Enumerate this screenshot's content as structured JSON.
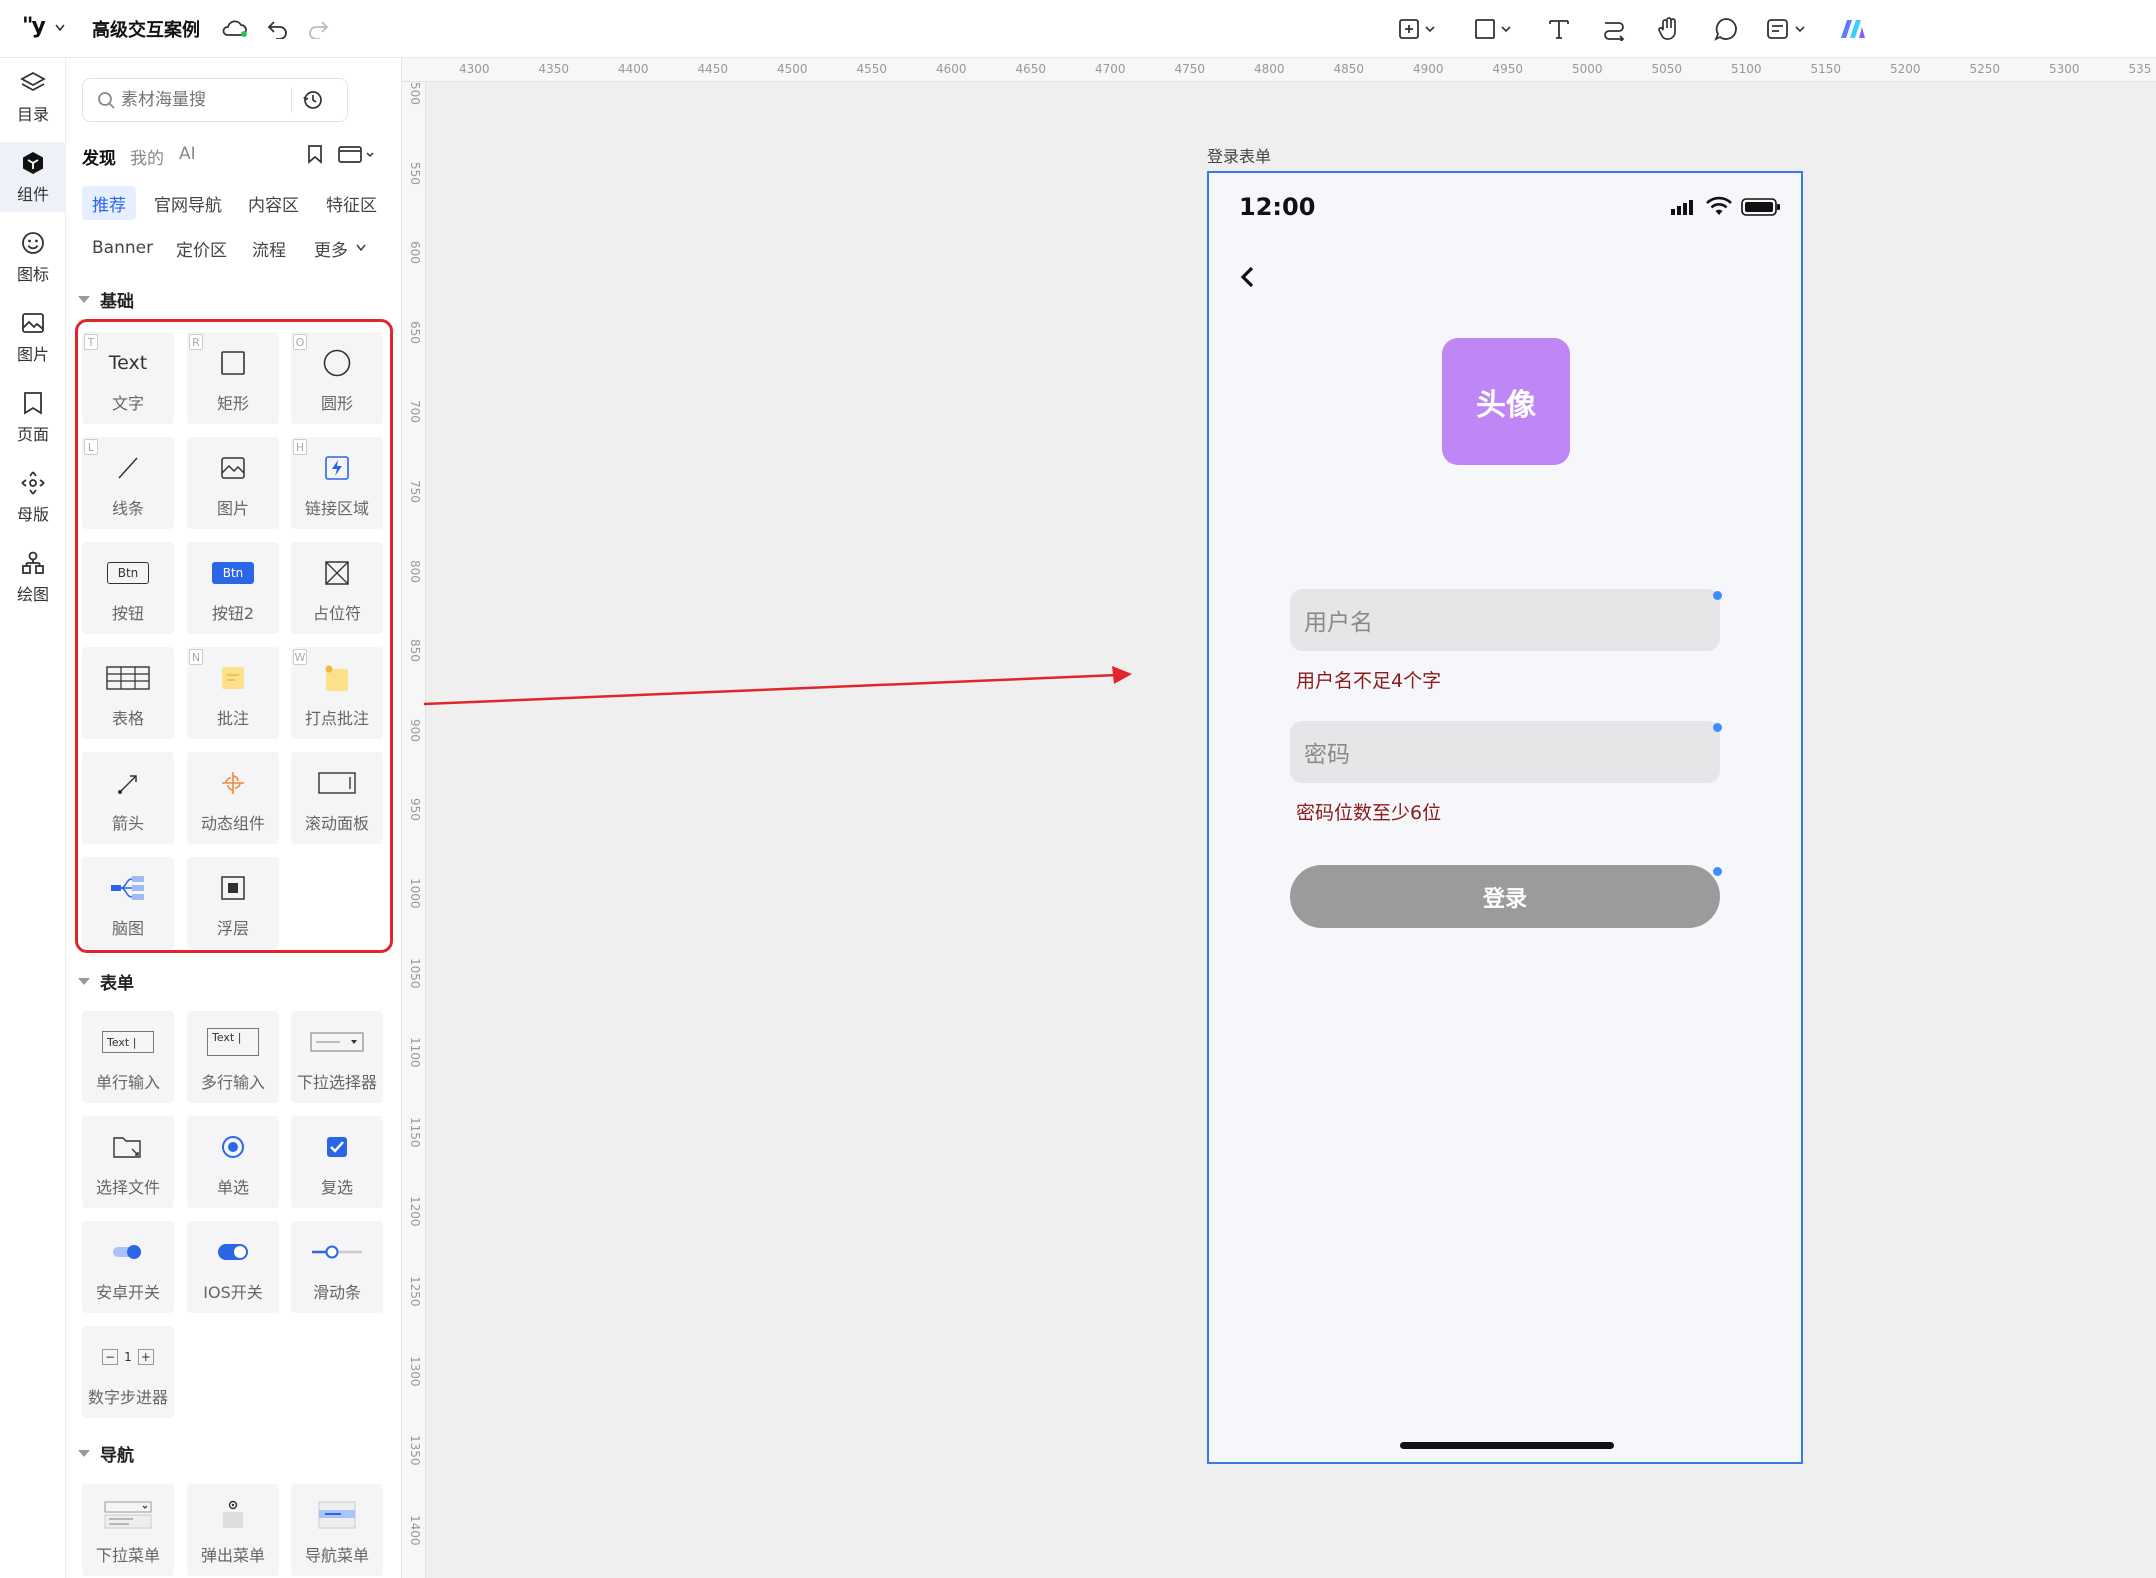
{
  "app": {
    "logo": "''y",
    "project_title": "高级交互案例"
  },
  "toolbar_icons": [
    "add-page-icon",
    "rectangle-icon",
    "text-tool-icon",
    "connector-icon",
    "hand-icon",
    "comment-icon",
    "note-icon",
    "ai-logo-icon"
  ],
  "rail": {
    "items": [
      {
        "label": "目录",
        "icon": "layers-icon"
      },
      {
        "label": "组件",
        "icon": "component-icon"
      },
      {
        "label": "图标",
        "icon": "smiley-icon"
      },
      {
        "label": "图片",
        "icon": "image-icon"
      },
      {
        "label": "页面",
        "icon": "page-icon"
      },
      {
        "label": "母版",
        "icon": "master-icon"
      },
      {
        "label": "绘图",
        "icon": "drawing-icon"
      }
    ]
  },
  "panel": {
    "search_placeholder": "素材海量搜",
    "tabs": [
      "发现",
      "我的",
      "AI"
    ],
    "categories_row1": [
      "推荐",
      "官网导航",
      "内容区",
      "特征区"
    ],
    "categories_row2": [
      "Banner",
      "定价区",
      "流程",
      "更多"
    ],
    "section_basic": "基础",
    "section_form": "表单",
    "section_nav": "导航",
    "basic": [
      {
        "label": "文字",
        "key": "T",
        "glyph": "Text"
      },
      {
        "label": "矩形",
        "key": "R"
      },
      {
        "label": "圆形",
        "key": "O"
      },
      {
        "label": "线条",
        "key": "L"
      },
      {
        "label": "图片",
        "key": ""
      },
      {
        "label": "链接区域",
        "key": "H"
      },
      {
        "label": "按钮",
        "key": "",
        "glyph": "Btn"
      },
      {
        "label": "按钮2",
        "key": "",
        "glyph": "Btn"
      },
      {
        "label": "占位符",
        "key": ""
      },
      {
        "label": "表格",
        "key": ""
      },
      {
        "label": "批注",
        "key": "N"
      },
      {
        "label": "打点批注",
        "key": "W"
      },
      {
        "label": "箭头",
        "key": ""
      },
      {
        "label": "动态组件",
        "key": ""
      },
      {
        "label": "滚动面板",
        "key": ""
      },
      {
        "label": "脑图",
        "key": ""
      },
      {
        "label": "浮层",
        "key": ""
      }
    ],
    "form": [
      {
        "label": "单行输入",
        "glyph": "Text |"
      },
      {
        "label": "多行输入",
        "glyph": "Text |"
      },
      {
        "label": "下拉选择器"
      },
      {
        "label": "选择文件"
      },
      {
        "label": "单选"
      },
      {
        "label": "复选"
      },
      {
        "label": "安卓开关"
      },
      {
        "label": "IOS开关"
      },
      {
        "label": "滑动条"
      },
      {
        "label": "数字步进器",
        "glyph": "1"
      }
    ],
    "nav": [
      {
        "label": "下拉菜单"
      },
      {
        "label": "弹出菜单"
      },
      {
        "label": "导航菜单"
      }
    ]
  },
  "rulers": {
    "top": [
      "4300",
      "4350",
      "4400",
      "4450",
      "4500",
      "4550",
      "4600",
      "4650",
      "4700",
      "4750",
      "4800",
      "4850",
      "4900",
      "4950",
      "5000",
      "5050",
      "5100",
      "5150",
      "5200",
      "5250",
      "5300",
      "535"
    ],
    "left": [
      "500",
      "550",
      "600",
      "650",
      "700",
      "750",
      "800",
      "850",
      "900",
      "950",
      "1000",
      "1050",
      "1100",
      "1150",
      "1200",
      "1250",
      "1300",
      "1350",
      "1400"
    ]
  },
  "artboard": {
    "label": "登录表单",
    "status_time": "12:00",
    "avatar_text": "头像",
    "username_placeholder": "用户名",
    "username_error": "用户名不足4个字",
    "password_placeholder": "密码",
    "password_error": "密码位数至少6位",
    "login_button": "登录"
  },
  "colors": {
    "accent": "#2a66e6",
    "highlight_box": "#e0262b",
    "avatar_bg": "#bf86f5",
    "login_btn_bg": "#9b9b9b",
    "error_text": "#8b1a1a",
    "artboard_border": "#3b78e7"
  }
}
